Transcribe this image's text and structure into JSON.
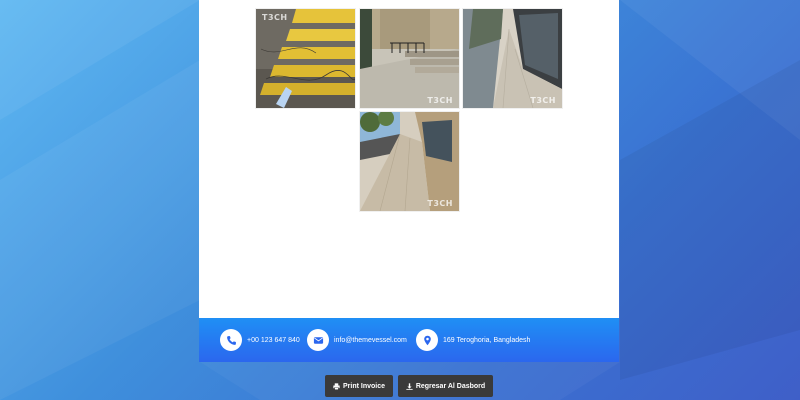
{
  "gallery": {
    "watermark": "T3CH",
    "photos": [
      {
        "name": "crosswalk-photo",
        "desc_icon": "crosswalk"
      },
      {
        "name": "stairs-building-photo",
        "desc_icon": "stairs"
      },
      {
        "name": "sidewalk-storefront-photo",
        "desc_icon": "sidewalk"
      },
      {
        "name": "sidewalk-trees-photo",
        "desc_icon": "sidewalk"
      }
    ]
  },
  "footer": {
    "phone": "+00 123 647 840",
    "email": "info@themevessel.com",
    "address": "169 Teroghoria, Bangladesh"
  },
  "actions": {
    "print_label": "Print Invoice",
    "back_label": "Regresar Al Dasbord"
  },
  "colors": {
    "footer_start": "#1f8ff5",
    "footer_end": "#2b67ee",
    "button_bg": "#3a3a3a",
    "icon_color": "#2b67ee"
  }
}
